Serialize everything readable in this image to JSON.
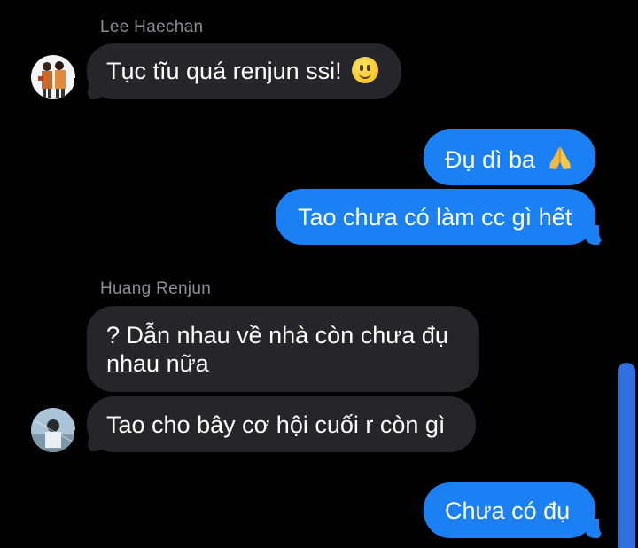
{
  "conversation": {
    "groups": [
      {
        "sender": "Lee Haechan",
        "messages": [
          {
            "text": "Tục tĩu quá renjun ssi!",
            "emoji": "slightly-smiling-face-icon"
          }
        ]
      },
      {
        "sender": "me",
        "messages": [
          {
            "text": "Đụ dì ba",
            "emoji": "folded-hands-icon"
          },
          {
            "text": "Tao chưa có làm cc gì hết"
          }
        ]
      },
      {
        "sender": "Huang Renjun",
        "messages": [
          {
            "line1": "? Dẫn nhau về nhà còn chưa đụ",
            "line2": "nhau nữa"
          },
          {
            "text": "Tao cho bây cơ hội cuối r còn gì"
          }
        ]
      },
      {
        "sender": "me",
        "messages": [
          {
            "text": "Chưa có đụ"
          }
        ]
      }
    ]
  },
  "colors": {
    "background": "#000000",
    "incoming_bubble": "#26252a",
    "outgoing_bubble": "#1a80f4",
    "sender_name": "#8e8e93",
    "scrollbar": "#2f6fe0"
  },
  "icons": {
    "avatar_haechan": "avatar-lee-haechan",
    "avatar_renjun": "avatar-huang-renjun"
  }
}
